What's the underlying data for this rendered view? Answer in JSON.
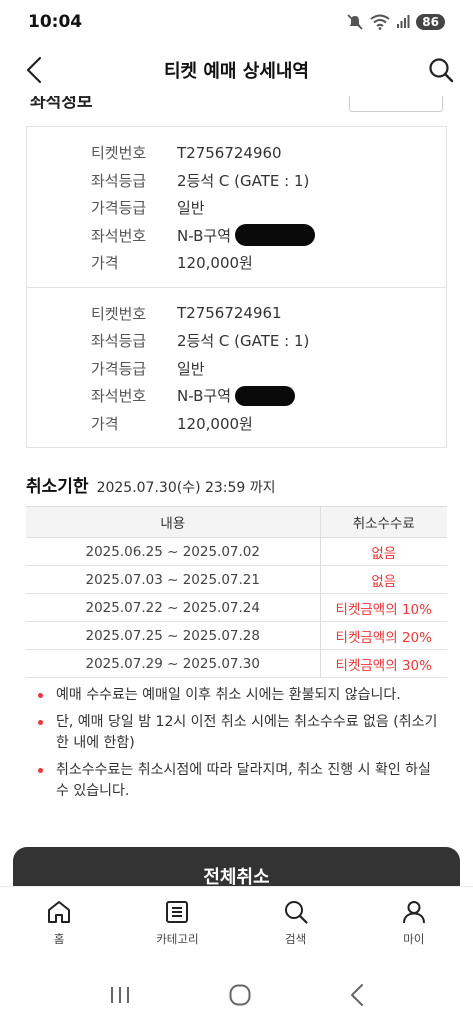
{
  "status": {
    "time": "10:04",
    "battery": "86"
  },
  "header": {
    "title": "티켓 예매 상세내역"
  },
  "section": {
    "cut_title": "좌석정보"
  },
  "tickets": [
    {
      "rows": [
        {
          "label": "티켓번호",
          "value": "T2756724960"
        },
        {
          "label": "좌석등급",
          "value": "2등석 C (GATE : 1)"
        },
        {
          "label": "가격등급",
          "value": "일반"
        },
        {
          "label": "좌석번호",
          "value": "N-B구역"
        },
        {
          "label": "가격",
          "value": "120,000원"
        }
      ]
    },
    {
      "rows": [
        {
          "label": "티켓번호",
          "value": "T2756724961"
        },
        {
          "label": "좌석등급",
          "value": "2등석 C (GATE : 1)"
        },
        {
          "label": "가격등급",
          "value": "일반"
        },
        {
          "label": "좌석번호",
          "value": "N-B구역"
        },
        {
          "label": "가격",
          "value": "120,000원"
        }
      ]
    }
  ],
  "cancel_deadline": {
    "label": "취소기한",
    "value": "2025.07.30(수) 23:59 까지"
  },
  "fee_table": {
    "headers": [
      "내용",
      "취소수수료"
    ],
    "rows": [
      {
        "period": "2025.06.25 ~ 2025.07.02",
        "fee": "없음"
      },
      {
        "period": "2025.07.03 ~ 2025.07.21",
        "fee": "없음"
      },
      {
        "period": "2025.07.22 ~ 2025.07.24",
        "fee": "티켓금액의 10%"
      },
      {
        "period": "2025.07.25 ~ 2025.07.28",
        "fee": "티켓금액의 20%"
      },
      {
        "period": "2025.07.29 ~ 2025.07.30",
        "fee": "티켓금액의 30%"
      }
    ]
  },
  "notes": [
    "예매 수수료는 예매일 이후 취소 시에는 환불되지 않습니다.",
    "단, 예매 당일 밤 12시 이전 취소 시에는 취소수수료 없음 (취소기한 내에 한함)",
    "취소수수료는 취소시점에 따라 달라지며, 취소 진행 시 확인 하실 수 있습니다."
  ],
  "cancel_all_label": "전체취소",
  "bottom_nav": [
    {
      "label": "홈",
      "icon": "home-icon"
    },
    {
      "label": "카테고리",
      "icon": "category-icon"
    },
    {
      "label": "검색",
      "icon": "search-icon"
    },
    {
      "label": "마이",
      "icon": "user-icon"
    }
  ],
  "colors": {
    "accent_red": "#e8393a",
    "dark_button": "#333333"
  }
}
